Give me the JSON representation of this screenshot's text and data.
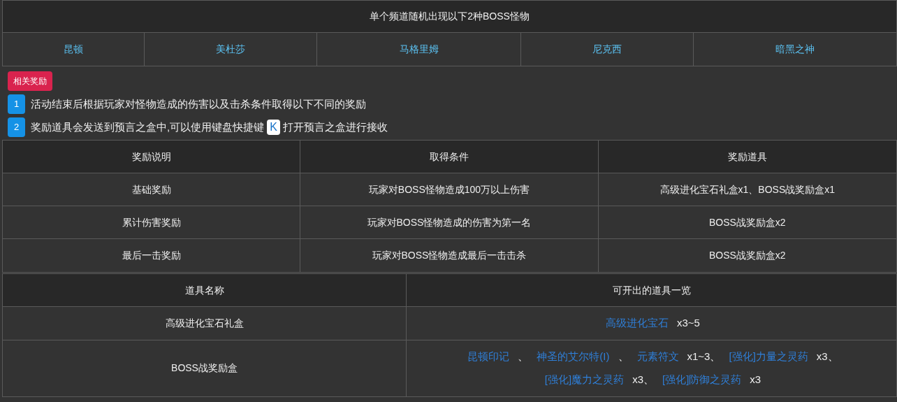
{
  "boss_table": {
    "title": "单个频道随机出现以下2种BOSS怪物",
    "bosses": [
      "昆顿",
      "美杜莎",
      "马格里姆",
      "尼克西",
      "暗黑之神"
    ]
  },
  "reward_badge": "相关奖励",
  "notes": [
    {
      "number": "1",
      "parts": [
        {
          "kind": "text",
          "text": "活动结束后根据玩家对怪物造成的伤害以及击杀条件取得以下不同的奖励"
        }
      ]
    },
    {
      "number": "2",
      "parts": [
        {
          "kind": "text",
          "text": "奖励道具会发送到预言之盒中,可以使用键盘快捷键"
        },
        {
          "kind": "key",
          "text": "K"
        },
        {
          "kind": "text",
          "text": "打开预言之盒进行接收"
        }
      ]
    }
  ],
  "reward_table": {
    "columns": [
      "奖励说明",
      "取得条件",
      "奖励道具"
    ],
    "rows": [
      [
        "基础奖励",
        "玩家对BOSS怪物造成100万以上伤害",
        "高级进化宝石礼盒x1、BOSS战奖励盒x1"
      ],
      [
        "累计伤害奖励",
        "玩家对BOSS怪物造成的伤害为第一名",
        "BOSS战奖励盒x2"
      ],
      [
        "最后一击奖励",
        "玩家对BOSS怪物造成最后一击击杀",
        "BOSS战奖励盒x2"
      ]
    ]
  },
  "item_table": {
    "columns": [
      "道具名称",
      "可开出的道具一览"
    ],
    "rows": [
      {
        "name": "高级进化宝石礼盒",
        "lines": [
          [
            {
              "kind": "link",
              "text": "高级进化宝石"
            },
            {
              "kind": "text",
              "text": "x3~5"
            }
          ]
        ]
      },
      {
        "name": "BOSS战奖励盒",
        "lines": [
          [
            {
              "kind": "link",
              "text": "昆顿印记"
            },
            {
              "kind": "text",
              "text": "、"
            },
            {
              "kind": "link",
              "text": "神圣的艾尔特(I)"
            },
            {
              "kind": "text",
              "text": "、"
            },
            {
              "kind": "link",
              "text": "元素符文"
            },
            {
              "kind": "text",
              "text": "x1~3、"
            },
            {
              "kind": "link",
              "text": "[强化]力量之灵药"
            },
            {
              "kind": "text",
              "text": "x3、"
            }
          ],
          [
            {
              "kind": "link",
              "text": "[强化]魔力之灵药"
            },
            {
              "kind": "text",
              "text": "x3、"
            },
            {
              "kind": "link",
              "text": "[强化]防御之灵药"
            },
            {
              "kind": "text",
              "text": "x3"
            }
          ]
        ]
      }
    ]
  }
}
